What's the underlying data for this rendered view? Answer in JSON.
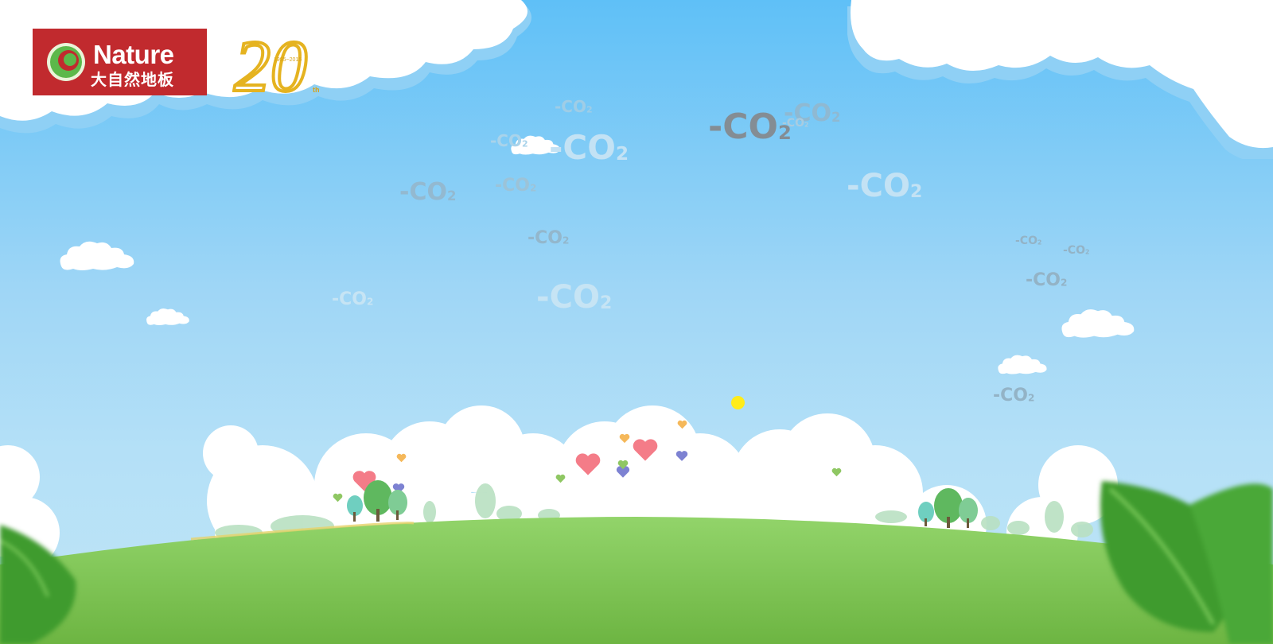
{
  "brand": {
    "name_en": "Nature",
    "name_cn": "大自然地板",
    "bg_color": "#c12a2e",
    "ring_color": "#5cb84a"
  },
  "anniversary": {
    "number": "20",
    "years": "1995~2015",
    "suffix": "th",
    "color": "#e5b320"
  },
  "co2_labels": [
    {
      "main": "-CO",
      "sub": "2"
    },
    {
      "main": "-CO",
      "sub": "2"
    },
    {
      "main": "-CO",
      "sub": "2"
    },
    {
      "main": "-CO",
      "sub": "2"
    },
    {
      "main": "-CO",
      "sub": "2"
    },
    {
      "main": "-CO",
      "sub": "2"
    },
    {
      "main": "-CO",
      "sub": "2"
    },
    {
      "main": "-CO",
      "sub": "2"
    },
    {
      "main": "-CO",
      "sub": "2"
    },
    {
      "main": "-CO",
      "sub": "2"
    },
    {
      "main": "-CO",
      "sub": "2"
    },
    {
      "main": "-CO",
      "sub": "2"
    },
    {
      "main": "-CO",
      "sub": "2"
    },
    {
      "main": "-CO",
      "sub": "2"
    },
    {
      "main": "-CO",
      "sub": "2"
    },
    {
      "main": "-CO",
      "sub": "2"
    }
  ],
  "colors": {
    "sky_top": "#5fc0f7",
    "sky_bottom": "#bfe5f6",
    "grass": "#7cc450",
    "sun": "#ffec1a",
    "heart_pink": "#f47c88"
  }
}
